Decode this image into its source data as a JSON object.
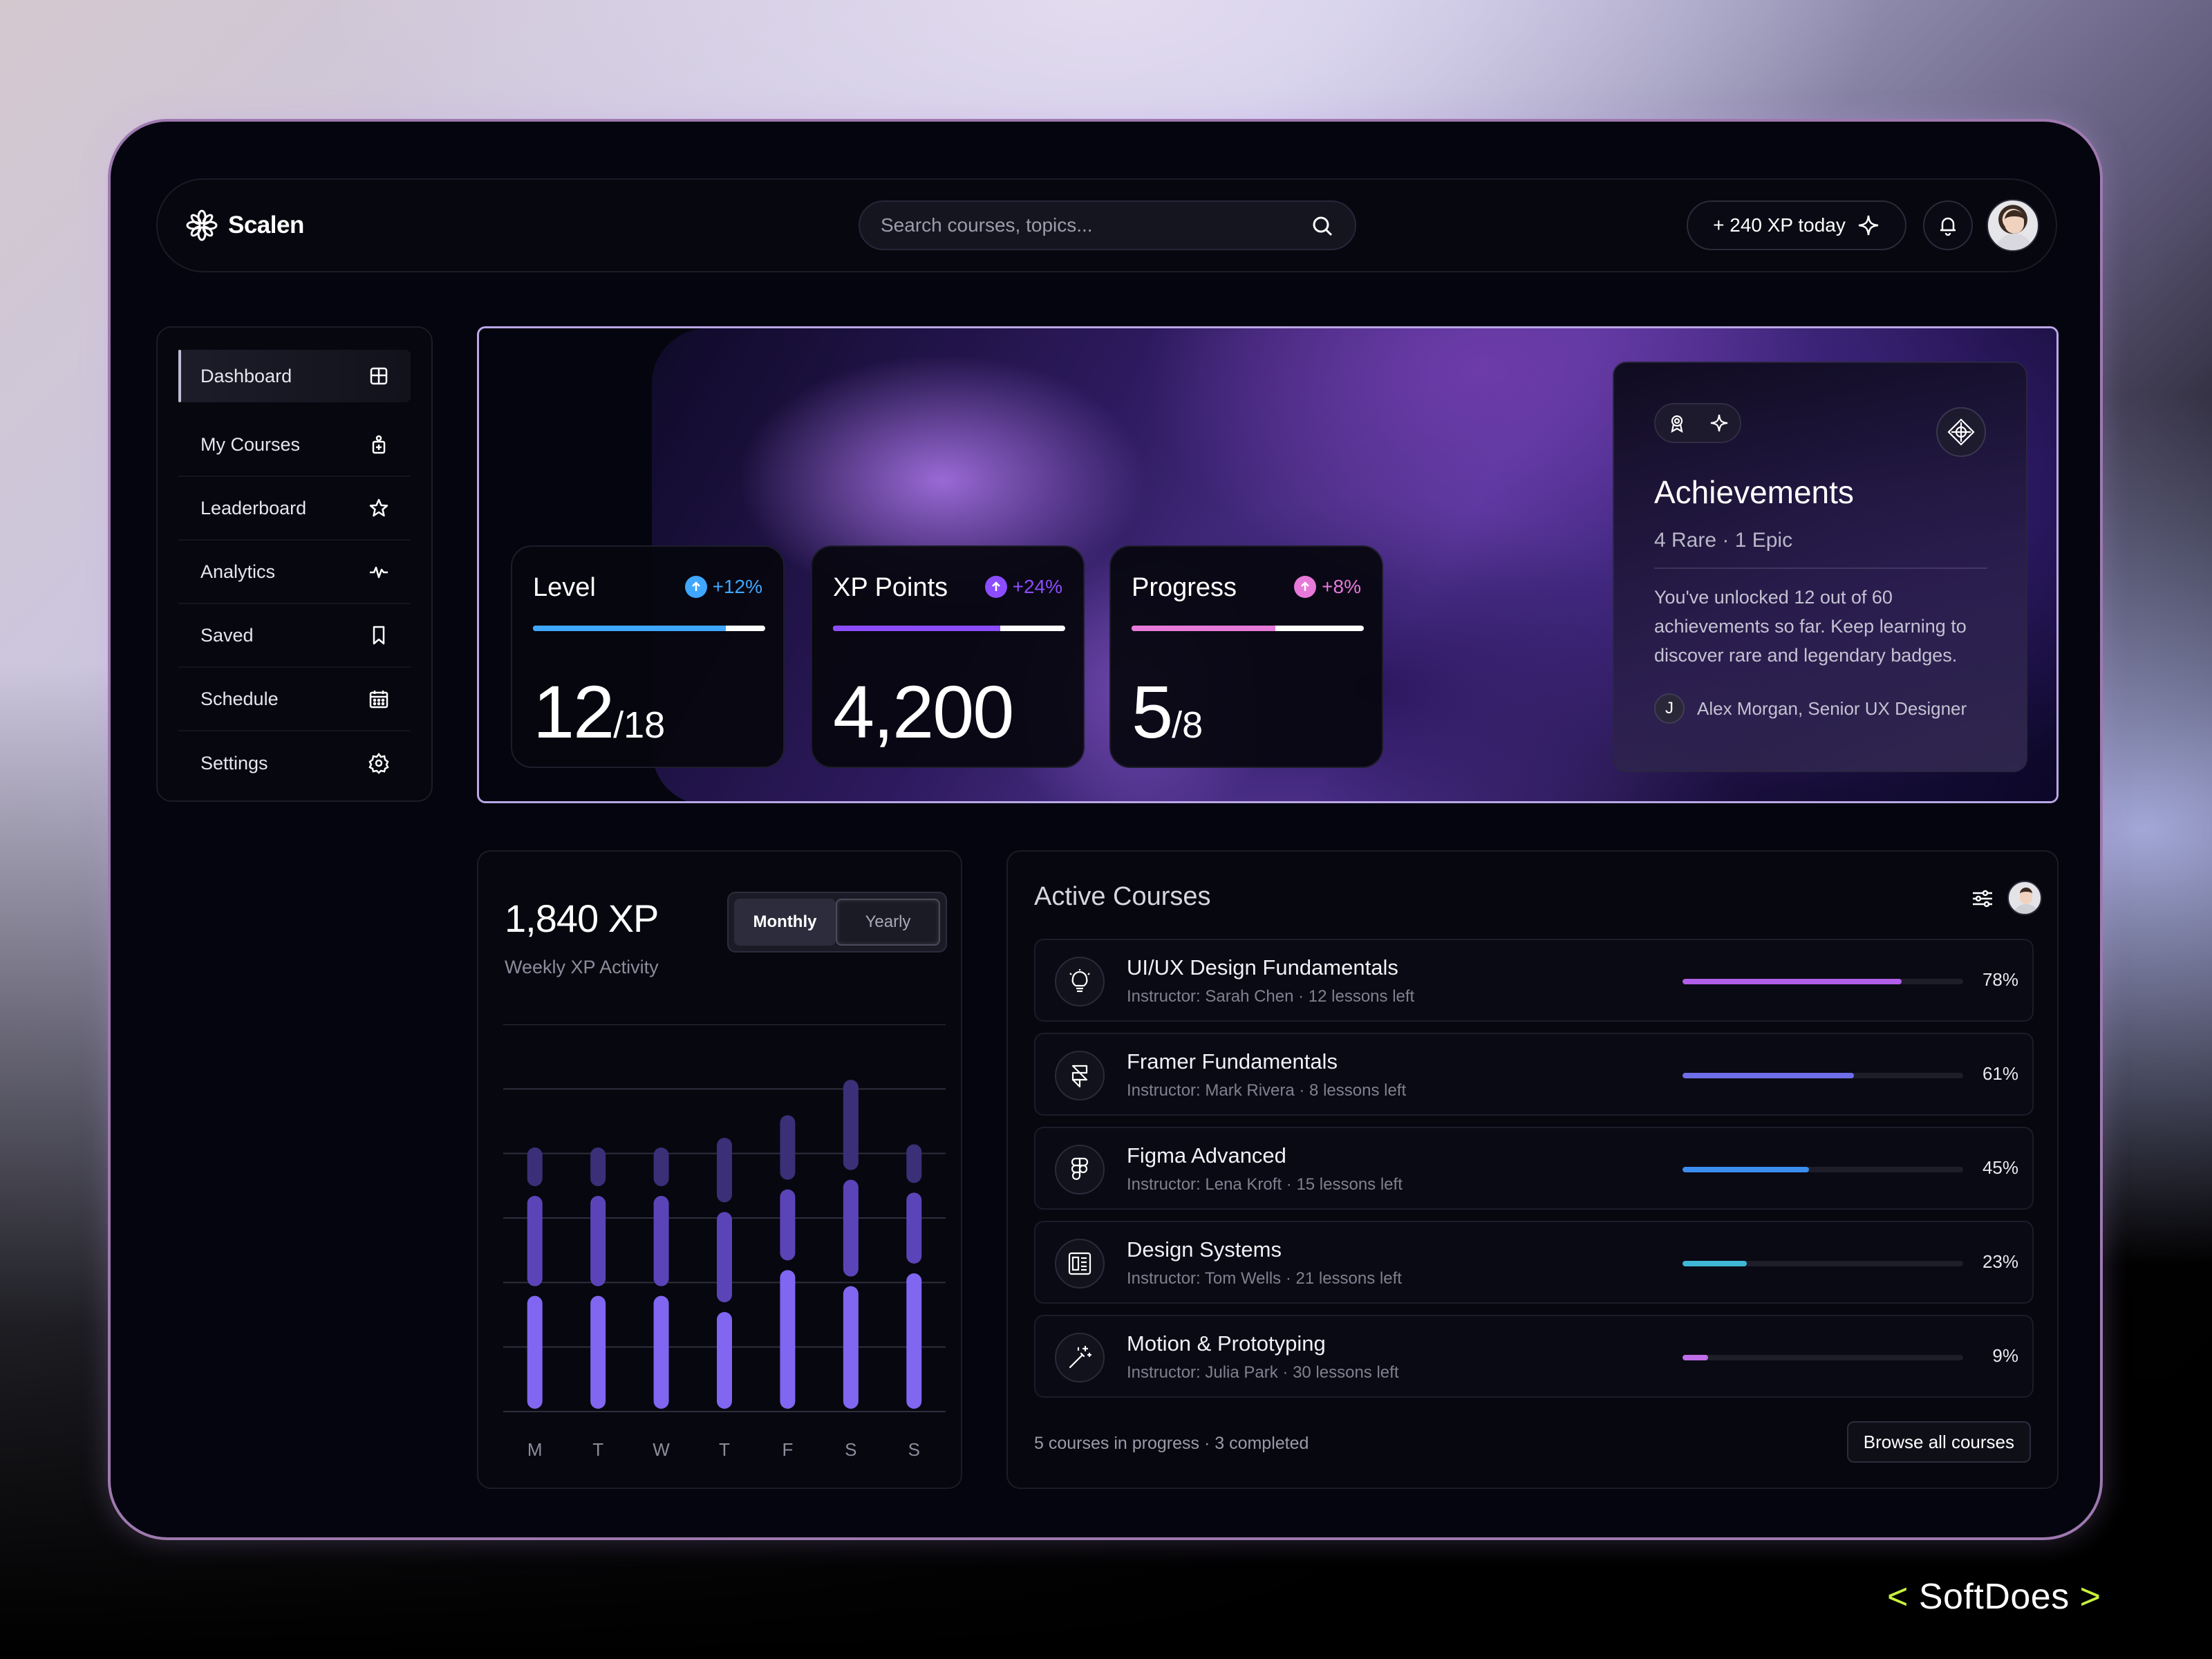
{
  "app": {
    "name": "Scalen"
  },
  "search": {
    "placeholder": "Search courses, topics..."
  },
  "header": {
    "xp_today": "+ 240 XP today"
  },
  "sidebar": {
    "items": [
      {
        "label": "Dashboard",
        "icon": "dashboard-grid-icon",
        "active": true
      },
      {
        "label": "My Courses",
        "icon": "courses-icon"
      },
      {
        "label": "Leaderboard",
        "icon": "star-icon"
      },
      {
        "label": "Analytics",
        "icon": "activity-icon"
      },
      {
        "label": "Saved",
        "icon": "bookmark-icon"
      },
      {
        "label": "Schedule",
        "icon": "calendar-icon"
      },
      {
        "label": "Settings",
        "icon": "settings-gear-icon"
      }
    ]
  },
  "stats": [
    {
      "title": "Level",
      "delta": "+12%",
      "value": "12",
      "sub": "/18",
      "progress": 0.83,
      "color": "#3fa7ff",
      "dot_color": "#3fa7ff"
    },
    {
      "title": "XP Points",
      "delta": "+24%",
      "value": "4,200",
      "sub": "",
      "progress": 0.72,
      "color": "#8b4dff",
      "dot_color": "#8b4dff"
    },
    {
      "title": "Progress",
      "delta": "+8%",
      "value": "5",
      "sub": "/8",
      "progress": 0.62,
      "color": "#e77ad9",
      "dot_color": "#e77ad9"
    }
  ],
  "achievements": {
    "title": "Achievements",
    "subtitle": "4 Rare · 1 Epic",
    "description": "You've unlocked 12 out of 60 achievements so far. Keep learning to discover rare and legendary badges.",
    "author_initial": "J",
    "author": "Alex Morgan, Senior UX Designer"
  },
  "activity": {
    "value": "1,840 XP",
    "label": "Weekly XP Activity",
    "toggle": {
      "monthly": "Monthly",
      "yearly": "Yearly",
      "selected": "Monthly"
    }
  },
  "chart_data": {
    "type": "bar",
    "title": "",
    "categories": [
      "M",
      "T",
      "W",
      "T",
      "F",
      "S",
      "S"
    ],
    "series": [
      {
        "values": [
          35,
          35,
          35,
          30,
          43,
          38,
          42
        ]
      },
      {
        "values": [
          28,
          28,
          28,
          28,
          22,
          30,
          22
        ]
      },
      {
        "values": [
          12,
          12,
          12,
          20,
          20,
          28,
          12
        ]
      }
    ],
    "colors": [
      "#8066f0",
      "#5b44b8",
      "#3b2f78"
    ],
    "gridlines": 7,
    "ylim": [
      0,
      120
    ]
  },
  "courses": {
    "title": "Active Courses",
    "items": [
      {
        "name": "UI/UX Design Fundamentals",
        "meta": "Instructor: Sarah Chen · 12 lessons left",
        "progress": 78,
        "pct": "78%",
        "color": "#b15ee8",
        "icon": "lightbulb-icon"
      },
      {
        "name": "Framer Fundamentals",
        "meta": "Instructor: Mark Rivera · 8 lessons left",
        "progress": 61,
        "pct": "61%",
        "color": "#6e6ee8",
        "icon": "framer-icon"
      },
      {
        "name": "Figma Advanced",
        "meta": "Instructor: Lena Kroft · 15 lessons left",
        "progress": 45,
        "pct": "45%",
        "color": "#3b8ef0",
        "icon": "figma-icon"
      },
      {
        "name": "Design Systems",
        "meta": "Instructor: Tom Wells · 21 lessons left",
        "progress": 23,
        "pct": "23%",
        "color": "#3fb8d8",
        "icon": "layout-icon"
      },
      {
        "name": "Motion & Prototyping",
        "meta": "Instructor: Julia Park · 30 lessons left",
        "progress": 9,
        "pct": "9%",
        "color": "#c06ee8",
        "icon": "magic-wand-icon"
      }
    ],
    "footer": "5 courses in progress · 3 completed",
    "browse_label": "Browse all courses"
  },
  "brand": {
    "lt": "<",
    "name": "SoftDoes",
    "gt": ">"
  }
}
